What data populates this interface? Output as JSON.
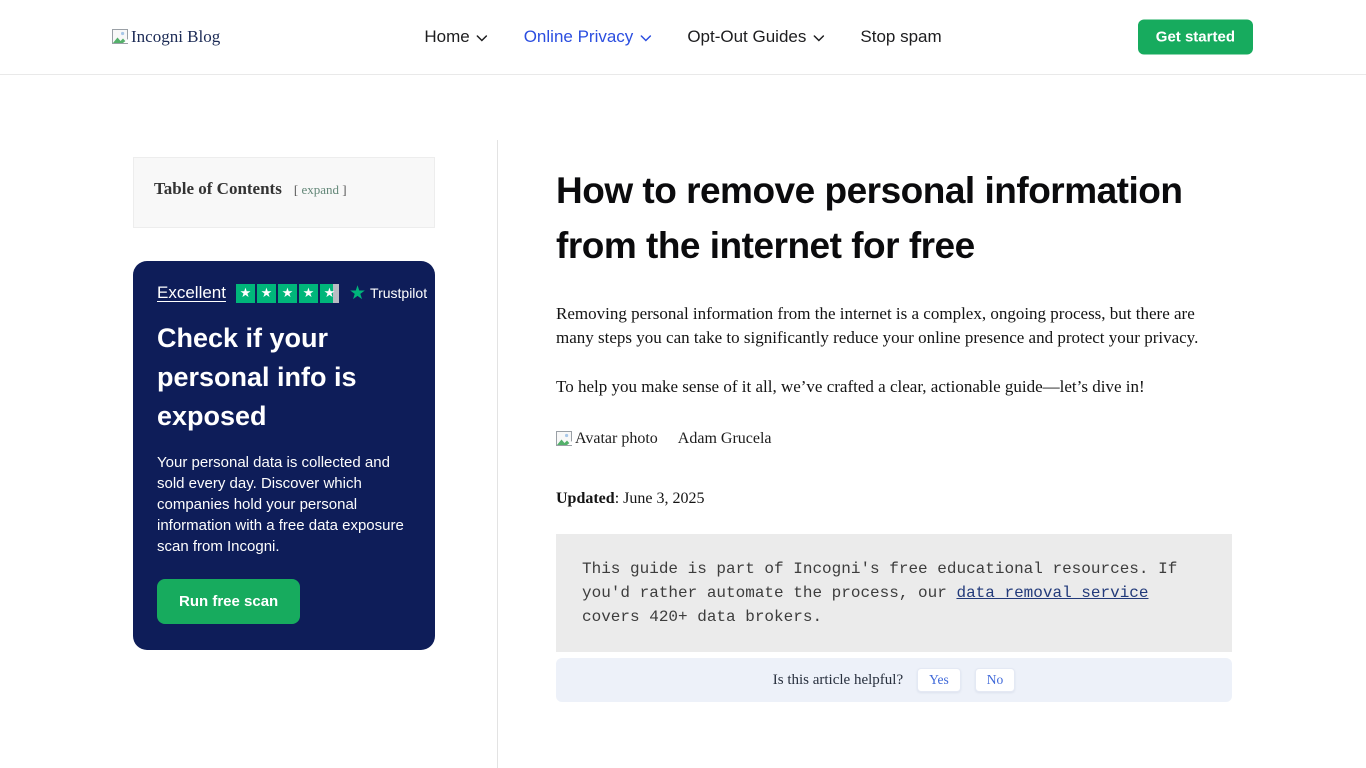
{
  "header": {
    "logo_alt": "Incogni Blog",
    "nav": [
      {
        "label": "Home",
        "has_dropdown": true,
        "active": false
      },
      {
        "label": "Online Privacy",
        "has_dropdown": true,
        "active": true
      },
      {
        "label": "Opt-Out Guides",
        "has_dropdown": true,
        "active": false
      },
      {
        "label": "Stop spam",
        "has_dropdown": false,
        "active": false
      }
    ],
    "cta_label": "Get started"
  },
  "sidebar": {
    "toc": {
      "title": "Table of Contents",
      "bracket_open": "[",
      "expand_label": "expand",
      "bracket_close": "]"
    },
    "promo": {
      "rating_label": "Excellent",
      "rating_stars": 4.5,
      "trustpilot_label": "Trustpilot",
      "heading": "Check if your personal info is exposed",
      "body": "Your personal data is collected and sold every day. Discover which companies hold your personal information with a free data exposure scan from Incogni.",
      "cta_label": "Run free scan"
    }
  },
  "article": {
    "title": "How to remove personal information from the internet for free",
    "intro_1": "Removing personal information from the internet is a complex, ongoing process, but there are many steps you can take to significantly reduce your online presence and protect your privacy.",
    "intro_2": "To help you make sense of it all, we’ve crafted a clear, actionable guide—let’s dive in!",
    "author": {
      "avatar_alt": "Avatar photo",
      "name": "Adam Grucela"
    },
    "updated_label": "Updated",
    "updated_date": ": June 3, 2025",
    "note": {
      "pre": "This guide is part of Incogni's free educational resources. If you'd rather automate the process, our ",
      "link": "data removal service",
      "post": " covers 420+ data brokers."
    },
    "feedback": {
      "question": "Is this article helpful?",
      "yes": "Yes",
      "no": "No"
    }
  },
  "icons": {
    "star_glyph": "★"
  },
  "colors": {
    "accent_blue": "#2b4ee0",
    "button_green": "#17ab5e",
    "trustpilot_green": "#00b67a",
    "card_navy": "#0e1d59",
    "note_bg": "#ebebeb",
    "feedback_bg": "#edf1f9"
  }
}
